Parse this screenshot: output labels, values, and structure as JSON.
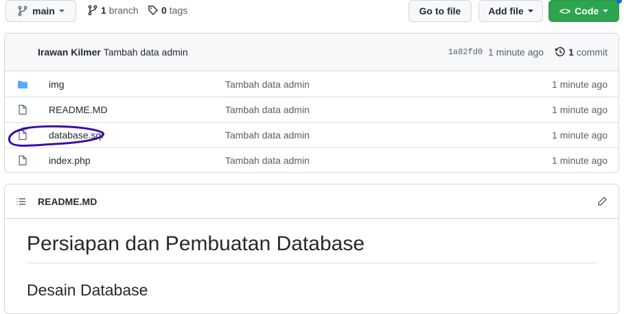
{
  "toolbar": {
    "branch": "main",
    "branch_count": "1",
    "branch_label": "branch",
    "tag_count": "0",
    "tag_label": "tags",
    "go_to_file": "Go to file",
    "add_file": "Add file",
    "code": "Code"
  },
  "commit": {
    "author": "Irawan Kilmer",
    "message": "Tambah data admin",
    "sha": "1a82fd0",
    "time": "1 minute ago",
    "count": "1",
    "count_label": "commit"
  },
  "files": [
    {
      "name": "img",
      "type": "folder",
      "message": "Tambah data admin",
      "age": "1 minute ago"
    },
    {
      "name": "README.MD",
      "type": "file",
      "message": "Tambah data admin",
      "age": "1 minute ago"
    },
    {
      "name": "database.sql",
      "type": "file",
      "message": "Tambah data admin",
      "age": "1 minute ago"
    },
    {
      "name": "index.php",
      "type": "file",
      "message": "Tambah data admin",
      "age": "1 minute ago"
    }
  ],
  "readme": {
    "filename": "README.MD",
    "h1": "Persiapan dan Pembuatan Database",
    "h2": "Desain Database"
  },
  "colors": {
    "green": "#2da44e",
    "folder": "#54aeff",
    "annotation": "#3a0ca3"
  }
}
